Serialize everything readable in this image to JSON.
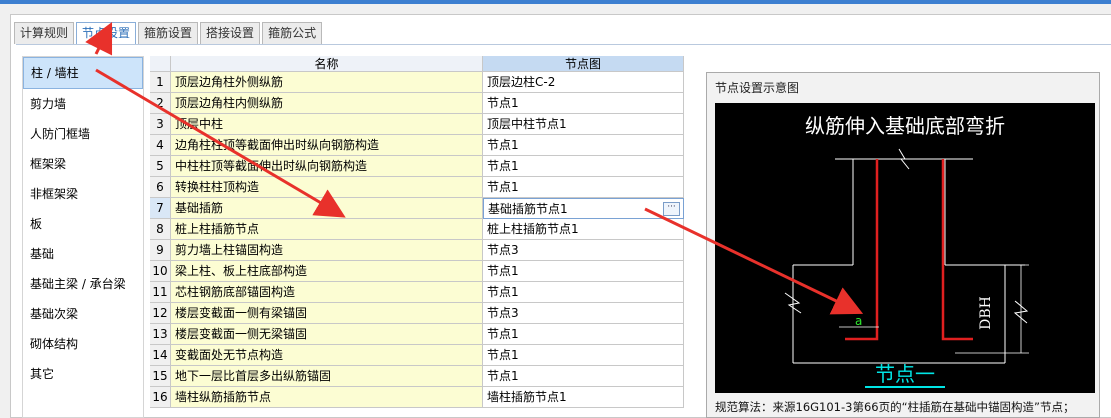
{
  "tabs": [
    {
      "label": "计算规则"
    },
    {
      "label": "节点设置"
    },
    {
      "label": "箍筋设置"
    },
    {
      "label": "搭接设置"
    },
    {
      "label": "箍筋公式"
    }
  ],
  "sidebar": {
    "items": [
      {
        "label": "柱 / 墙柱"
      },
      {
        "label": "剪力墙"
      },
      {
        "label": "人防门框墙"
      },
      {
        "label": "框架梁"
      },
      {
        "label": "非框架梁"
      },
      {
        "label": "板"
      },
      {
        "label": "基础"
      },
      {
        "label": "基础主梁 / 承台梁"
      },
      {
        "label": "基础次梁"
      },
      {
        "label": "砌体结构"
      },
      {
        "label": "其它"
      }
    ]
  },
  "grid": {
    "headers": {
      "name": "名称",
      "node": "节点图"
    },
    "rows": [
      {
        "num": "1",
        "name": "顶层边角柱外侧纵筋",
        "node": "顶层边柱C-2"
      },
      {
        "num": "2",
        "name": "顶层边角柱内侧纵筋",
        "node": "节点1"
      },
      {
        "num": "3",
        "name": "顶层中柱",
        "node": "顶层中柱节点1"
      },
      {
        "num": "4",
        "name": "边角柱柱顶等截面伸出时纵向钢筋构造",
        "node": "节点1"
      },
      {
        "num": "5",
        "name": "中柱柱顶等截面伸出时纵向钢筋构造",
        "node": "节点1"
      },
      {
        "num": "6",
        "name": "转换柱柱顶构造",
        "node": "节点1"
      },
      {
        "num": "7",
        "name": "基础插筋",
        "node": "基础插筋节点1"
      },
      {
        "num": "8",
        "name": "桩上柱插筋节点",
        "node": "桩上柱插筋节点1"
      },
      {
        "num": "9",
        "name": "剪力墙上柱锚固构造",
        "node": "节点3"
      },
      {
        "num": "10",
        "name": "梁上柱、板上柱底部构造",
        "node": "节点1"
      },
      {
        "num": "11",
        "name": "芯柱钢筋底部锚固构造",
        "node": "节点1"
      },
      {
        "num": "12",
        "name": "楼层变截面一侧有梁锚固",
        "node": "节点3"
      },
      {
        "num": "13",
        "name": "楼层变截面一侧无梁锚固",
        "node": "节点1"
      },
      {
        "num": "14",
        "name": "变截面处无节点构造",
        "node": "节点1"
      },
      {
        "num": "15",
        "name": "地下一层比首层多出纵筋锚固",
        "node": "节点1"
      },
      {
        "num": "16",
        "name": "墙柱纵筋插筋节点",
        "node": "墙柱插筋节点1"
      }
    ],
    "more_button": "···"
  },
  "dialog": {
    "title": "节点设置示意图",
    "diagram_title": "纵筋伸入基础底部弯折",
    "dim_label": "DBH",
    "a_label": "a",
    "caption": "节点一",
    "note": "规范算法：来源16G101-3第66页的“柱插筋在基础中锚固构造”节点；"
  },
  "colors": {
    "accent": "#2d6fb8",
    "arrow": "#e8312b",
    "name_cell_bg": "#fcfdd3",
    "diagram_bg": "#000000",
    "rebar": "#e02020",
    "caption": "#00e5e5",
    "label_green": "#2ee82e"
  }
}
